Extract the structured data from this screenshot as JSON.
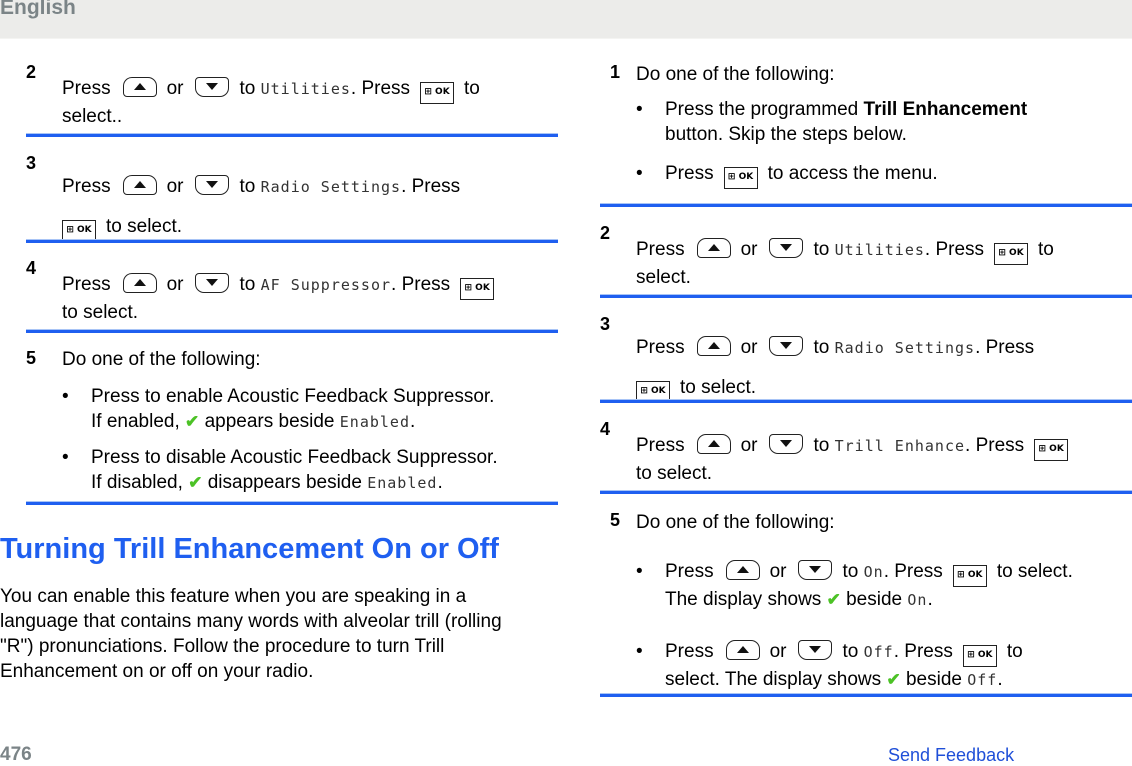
{
  "header": {
    "language": "English"
  },
  "icons": {
    "up": "up-arrow-button-icon",
    "down": "down-arrow-button-icon",
    "ok": "menu-ok-button-icon",
    "ok_label": "⊞ OK",
    "check": "✔"
  },
  "words": {
    "press": "Press",
    "or": "or",
    "to": "to",
    "to_select": "to select.",
    "to_select_dd": "select..",
    "select": "select.",
    "press2": ". Press"
  },
  "left": {
    "steps": [
      {
        "num": "2",
        "menu": "Utilities",
        "tail": "select.."
      },
      {
        "num": "3",
        "menu": "Radio Settings",
        "tail": "to select."
      },
      {
        "num": "4",
        "menu": "AF Suppressor",
        "tail": "to select."
      },
      {
        "num": "5",
        "intro": "Do one of the following:",
        "bullets": [
          {
            "line1": "Press to enable Acoustic Feedback Suppressor.",
            "pre": "If enabled,",
            "post": "appears beside",
            "value": "Enabled"
          },
          {
            "line1": "Press to disable Acoustic Feedback Suppressor.",
            "pre": "If disabled,",
            "post": "disappears beside",
            "value": "Enabled"
          }
        ]
      }
    ],
    "heading": "Turning Trill Enhancement On or Off",
    "paragraph": "You can enable this feature when you are speaking in a language that contains many words with alveolar trill (rolling \"R\") pronunciations. Follow the procedure to turn Trill Enhancement on or off on your radio."
  },
  "right": {
    "steps": [
      {
        "num": "1",
        "intro": "Do one of the following:",
        "bullet1": {
          "pre": "Press the programmed",
          "bold": "Trill Enhancement",
          "post": "button. Skip the steps below."
        },
        "bullet2": {
          "pre": "Press",
          "post": "to access the menu."
        }
      },
      {
        "num": "2",
        "menu": "Utilities",
        "tail": "select."
      },
      {
        "num": "3",
        "menu": "Radio Settings",
        "tail": "to select."
      },
      {
        "num": "4",
        "menu": "Trill Enhance",
        "tail": "to select."
      },
      {
        "num": "5",
        "intro": "Do one of the following:",
        "bullets": [
          {
            "menu": "On",
            "after": "to select.",
            "line2pre": "The display shows",
            "line2post": "beside",
            "value": "On"
          },
          {
            "menu": "Off",
            "after": "to",
            "line2pre": "select. The display shows",
            "line2post": "beside",
            "value": "Off"
          }
        ]
      }
    ]
  },
  "footer": {
    "page": "476",
    "link": "Send Feedback"
  }
}
